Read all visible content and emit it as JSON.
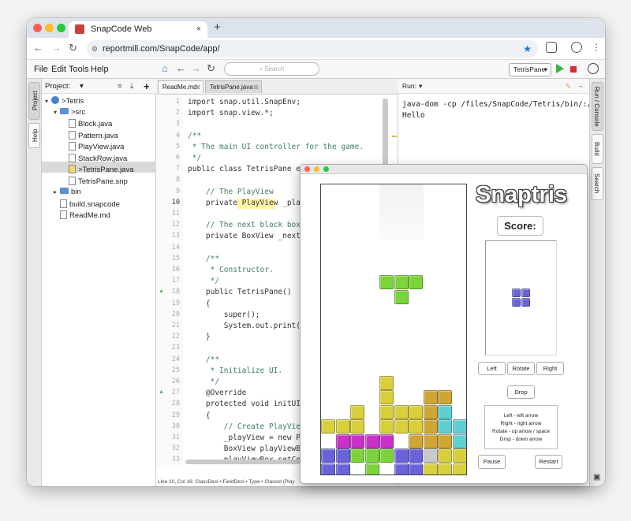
{
  "browser": {
    "tab_title": "SnapCode Web",
    "tab_close": "×",
    "new_tab": "+",
    "url": "reportmill.com/SnapCode/app/",
    "back": "←",
    "forward": "→",
    "reload": "↻"
  },
  "menubar": {
    "items": [
      "File",
      "Edit",
      "Tools",
      "Help"
    ],
    "search_placeholder": "Search",
    "run_target": "TetrisPane",
    "run_target_arrow": "▾"
  },
  "left_rail": {
    "tabs": [
      "Project",
      "Help"
    ]
  },
  "right_rail": {
    "tabs": [
      "Run / Console",
      "Build",
      "Search"
    ]
  },
  "project": {
    "header": "Project:",
    "dropdown": "▾",
    "tree": [
      {
        "label": ">Tetris",
        "level": 0,
        "kind": "project",
        "toggle": "▾"
      },
      {
        "label": ">src",
        "level": 1,
        "kind": "folder",
        "toggle": "▾"
      },
      {
        "label": "Block.java",
        "level": 2,
        "kind": "file"
      },
      {
        "label": "Pattern.java",
        "level": 2,
        "kind": "file"
      },
      {
        "label": "PlayView.java",
        "level": 2,
        "kind": "file"
      },
      {
        "label": "StackRow.java",
        "level": 2,
        "kind": "file"
      },
      {
        "label": ">TetrisPane.java",
        "level": 2,
        "kind": "file",
        "selected": true
      },
      {
        "label": "TetrisPane.snp",
        "level": 2,
        "kind": "file"
      },
      {
        "label": "bin",
        "level": 1,
        "kind": "folder",
        "toggle": "▸"
      },
      {
        "label": "build.snapcode",
        "level": 1,
        "kind": "file"
      },
      {
        "label": "ReadMe.md",
        "level": 1,
        "kind": "file"
      }
    ]
  },
  "editor": {
    "tabs": [
      {
        "label": "ReadMe.md",
        "active": false
      },
      {
        "label": "TetrisPane.java",
        "active": true
      }
    ],
    "tab_close": "⊠",
    "lines": [
      {
        "n": "1",
        "text": "import snap.util.SnapEnv;"
      },
      {
        "n": "2",
        "text": "import snap.view.*;"
      },
      {
        "n": "3",
        "text": ""
      },
      {
        "n": "4",
        "text": "/**",
        "comment": true
      },
      {
        "n": "5",
        "text": " * The main UI controller for the game.",
        "comment": true
      },
      {
        "n": "6",
        "text": " */",
        "comment": true
      },
      {
        "n": "7",
        "text": "public class TetrisPane ex"
      },
      {
        "n": "8",
        "text": ""
      },
      {
        "n": "9",
        "text": "    // The PlayView",
        "comment": true
      },
      {
        "n": "10",
        "text": "    private PlayView _play"
      },
      {
        "n": "11",
        "text": ""
      },
      {
        "n": "12",
        "text": "    // The next block box",
        "comment": true
      },
      {
        "n": "13",
        "text": "    private BoxView _nextB"
      },
      {
        "n": "14",
        "text": ""
      },
      {
        "n": "15",
        "text": "    /**",
        "comment": true
      },
      {
        "n": "16",
        "text": "     * Constructor.",
        "comment": true
      },
      {
        "n": "17",
        "text": "     */",
        "comment": true
      },
      {
        "n": "18",
        "text": "    public TetrisPane()",
        "marker": true
      },
      {
        "n": "19",
        "text": "    {"
      },
      {
        "n": "20",
        "text": "        super();"
      },
      {
        "n": "21",
        "text": "        System.out.print(\""
      },
      {
        "n": "22",
        "text": "    }"
      },
      {
        "n": "23",
        "text": ""
      },
      {
        "n": "24",
        "text": "    /**",
        "comment": true
      },
      {
        "n": "25",
        "text": "     * Initialize UI.",
        "comment": true
      },
      {
        "n": "26",
        "text": "     */",
        "comment": true
      },
      {
        "n": "27",
        "text": "    @Override",
        "marker": true
      },
      {
        "n": "28",
        "text": "    protected void initUI("
      },
      {
        "n": "29",
        "text": "    {"
      },
      {
        "n": "30",
        "text": "        // Create PlayView",
        "comment": true
      },
      {
        "n": "31",
        "text": "        _playView = new Pl"
      },
      {
        "n": "32",
        "text": "        BoxView playViewBo"
      },
      {
        "n": "33",
        "text": "        playViewBox.setCon"
      }
    ],
    "status": "Line 10, Col 16: ClassDecl • FieldDecl • Type • ClassId (Play"
  },
  "run_panel": {
    "header": "Run:",
    "dropdown": "▾",
    "output": [
      "java-dom -cp /files/SnapCode/Tetris/bin/:/ap",
      "Hello"
    ]
  },
  "game": {
    "title": "Snaptris",
    "score_label": "Score:",
    "buttons": {
      "left": "Left",
      "rotate": "Rotate",
      "right": "Right",
      "drop": "Drop",
      "pause": "Pause",
      "restart": "Restart"
    },
    "help_lines": [
      "Left  -  left arrow",
      "Right  -  right arrow",
      "Rotate  -  up arrow / space",
      "Drop  -  down arrow"
    ],
    "colors": {
      "green": "#7bd43a",
      "yellow": "#d9cf3a",
      "magenta": "#c932c9",
      "blue": "#6a63d8",
      "teal": "#5fd0d2",
      "gold": "#cfa534",
      "gray": "#c9c9c9"
    },
    "falling_piece": {
      "color": "green",
      "cells": [
        [
          0,
          0
        ],
        [
          1,
          0
        ],
        [
          2,
          0
        ],
        [
          1,
          1
        ]
      ]
    },
    "next_piece": {
      "color": "blue",
      "cells": [
        [
          0,
          0
        ],
        [
          1,
          0
        ],
        [
          0,
          1
        ],
        [
          1,
          1
        ]
      ]
    },
    "stack": [
      {
        "row": 13,
        "cells": [
          [
            4,
            "yellow"
          ]
        ]
      },
      {
        "row": 14,
        "cells": [
          [
            4,
            "yellow"
          ],
          [
            7,
            "gold"
          ],
          [
            8,
            "gold"
          ]
        ]
      },
      {
        "row": 15,
        "cells": [
          [
            2,
            "yellow"
          ],
          [
            4,
            "yellow"
          ],
          [
            5,
            "yellow"
          ],
          [
            6,
            "yellow"
          ],
          [
            7,
            "gold"
          ],
          [
            8,
            "teal"
          ]
        ]
      },
      {
        "row": 16,
        "cells": [
          [
            0,
            "yellow"
          ],
          [
            1,
            "yellow"
          ],
          [
            2,
            "yellow"
          ],
          [
            4,
            "yellow"
          ],
          [
            5,
            "yellow"
          ],
          [
            6,
            "yellow"
          ],
          [
            7,
            "gold"
          ],
          [
            8,
            "teal"
          ],
          [
            9,
            "teal"
          ]
        ]
      },
      {
        "row": 17,
        "cells": [
          [
            1,
            "magenta"
          ],
          [
            2,
            "magenta"
          ],
          [
            3,
            "magenta"
          ],
          [
            4,
            "magenta"
          ],
          [
            6,
            "gold"
          ],
          [
            7,
            "gold"
          ],
          [
            8,
            "gold"
          ],
          [
            9,
            "teal"
          ]
        ]
      },
      {
        "row": 18,
        "cells": [
          [
            0,
            "blue"
          ],
          [
            1,
            "blue"
          ],
          [
            2,
            "green"
          ],
          [
            3,
            "green"
          ],
          [
            4,
            "green"
          ],
          [
            5,
            "blue"
          ],
          [
            6,
            "blue"
          ],
          [
            7,
            "gray"
          ],
          [
            8,
            "yellow"
          ],
          [
            9,
            "yellow"
          ]
        ]
      },
      {
        "row": 19,
        "cells": [
          [
            0,
            "blue"
          ],
          [
            1,
            "blue"
          ],
          [
            3,
            "green"
          ],
          [
            5,
            "blue"
          ],
          [
            6,
            "blue"
          ],
          [
            7,
            "yellow"
          ],
          [
            8,
            "yellow"
          ],
          [
            9,
            "yellow"
          ]
        ]
      }
    ]
  }
}
